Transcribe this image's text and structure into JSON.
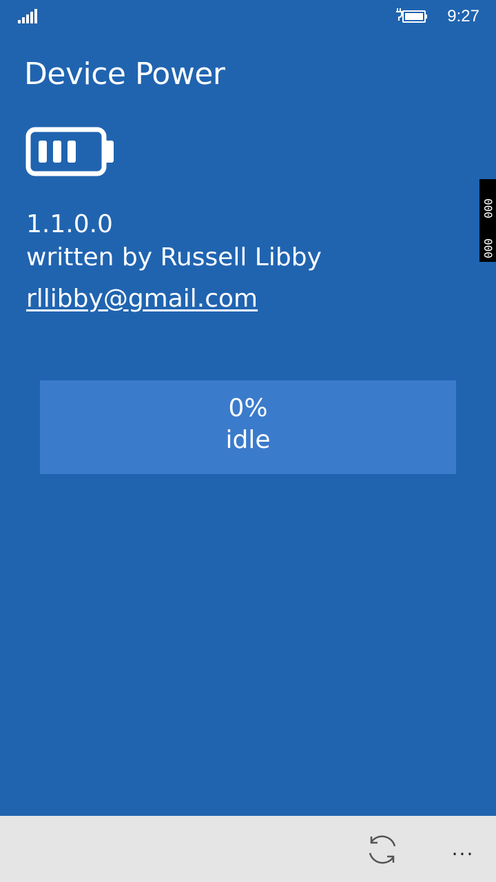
{
  "status_bar": {
    "time": "9:27",
    "signal_icon": "signal-bars-icon",
    "battery_icon": "battery-charging-icon"
  },
  "app": {
    "title": "Device Power",
    "logo_icon": "battery-icon",
    "version": "1.1.0.0",
    "author": "written by Russell Libby",
    "email": "rllibby@gmail.com"
  },
  "progress": {
    "percent_label": "0%",
    "state": "idle",
    "value": 0
  },
  "side_tab": {
    "labels": [
      "000",
      "000"
    ]
  },
  "app_bar": {
    "refresh_icon": "refresh-icon",
    "more_label": "..."
  },
  "colors": {
    "background": "#2064b0",
    "panel": "#3b7bcb",
    "app_bar": "#e5e5e5",
    "text": "#ffffff"
  }
}
